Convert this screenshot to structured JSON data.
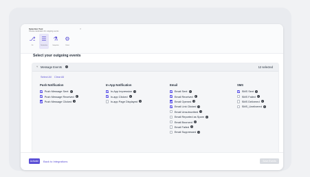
{
  "header": {
    "title": "Selection Tool",
    "subtitle": "Choose destination for outgoing events",
    "tag": "Key Tool",
    "destinations": [
      {
        "label": "Git",
        "icon": "git-icon",
        "active": false
      },
      {
        "label": "Destination",
        "icon": "stack-icon",
        "active": true
      },
      {
        "label": "Integration",
        "icon": "flask-icon",
        "active": false
      },
      {
        "label": "Cohort",
        "icon": "gear-icon",
        "active": false
      }
    ]
  },
  "section_title": "Select your outgoing events",
  "panel": {
    "title": "Message Events",
    "selected_count": "12 selected",
    "select_all": "Select All",
    "clear_all": "Clear All"
  },
  "columns": [
    {
      "title": "Push Notification",
      "events": [
        {
          "label": "Push Message Sent",
          "checked": true
        },
        {
          "label": "Push Message Received",
          "checked": true
        },
        {
          "label": "Push Message Clicked",
          "checked": true
        }
      ]
    },
    {
      "title": "In-App Notification",
      "events": [
        {
          "label": "In-App Impression",
          "checked": true
        },
        {
          "label": "In-app Clicked",
          "checked": true
        },
        {
          "label": "In-app Page Displayed",
          "checked": false
        }
      ]
    },
    {
      "title": "Email",
      "events": [
        {
          "label": "Email Sent",
          "checked": true
        },
        {
          "label": "Email Received",
          "checked": true
        },
        {
          "label": "Email Opened",
          "checked": true
        },
        {
          "label": "Email Link Clicked",
          "checked": true
        },
        {
          "label": "Email Unsubscribed",
          "checked": false
        },
        {
          "label": "Email Reported as Spam",
          "checked": false
        },
        {
          "label": "Email Bounced",
          "checked": false
        },
        {
          "label": "Email Failed",
          "checked": false
        },
        {
          "label": "Email Suppressed",
          "checked": false
        }
      ]
    },
    {
      "title": "SMS",
      "events": [
        {
          "label": "SMS Sent",
          "checked": true
        },
        {
          "label": "SMS Failed",
          "checked": false
        },
        {
          "label": "SMS Delivered",
          "checked": false
        },
        {
          "label": "SMS_Unelivered",
          "checked": false
        }
      ]
    }
  ],
  "footer": {
    "activate": "Activate",
    "back": "Back to Integrations",
    "save": "Save Events"
  },
  "colors": {
    "accent": "#5b4fd6",
    "checkbox": "#4f46e5"
  }
}
